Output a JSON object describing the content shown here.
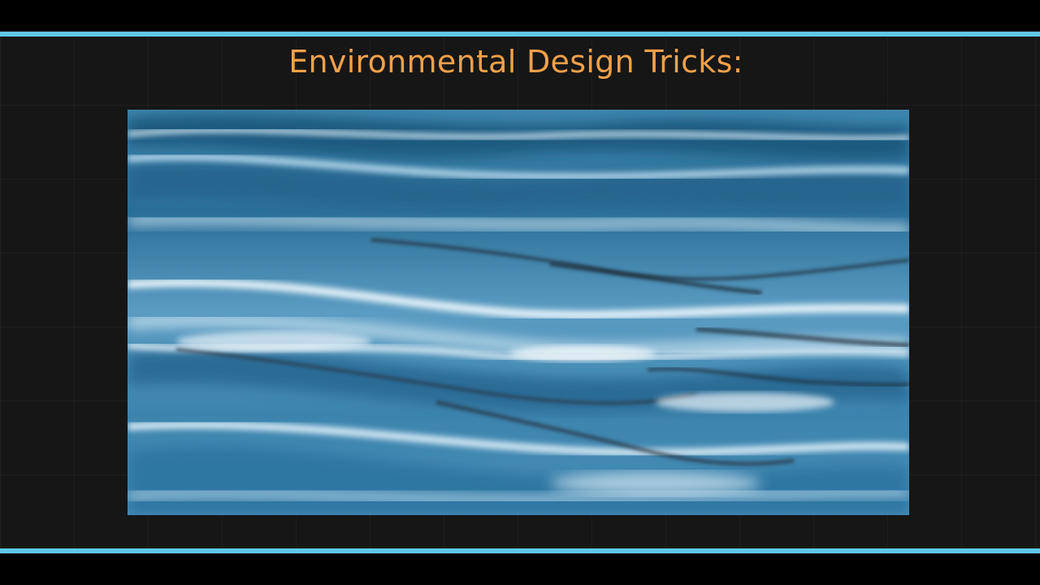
{
  "slide": {
    "title": "Environmental Design Tricks:",
    "accent_color": "#5fc8ea",
    "title_color": "#f2a04a",
    "background_color": "#161616"
  },
  "image": {
    "subject": "water-waves-photo"
  }
}
